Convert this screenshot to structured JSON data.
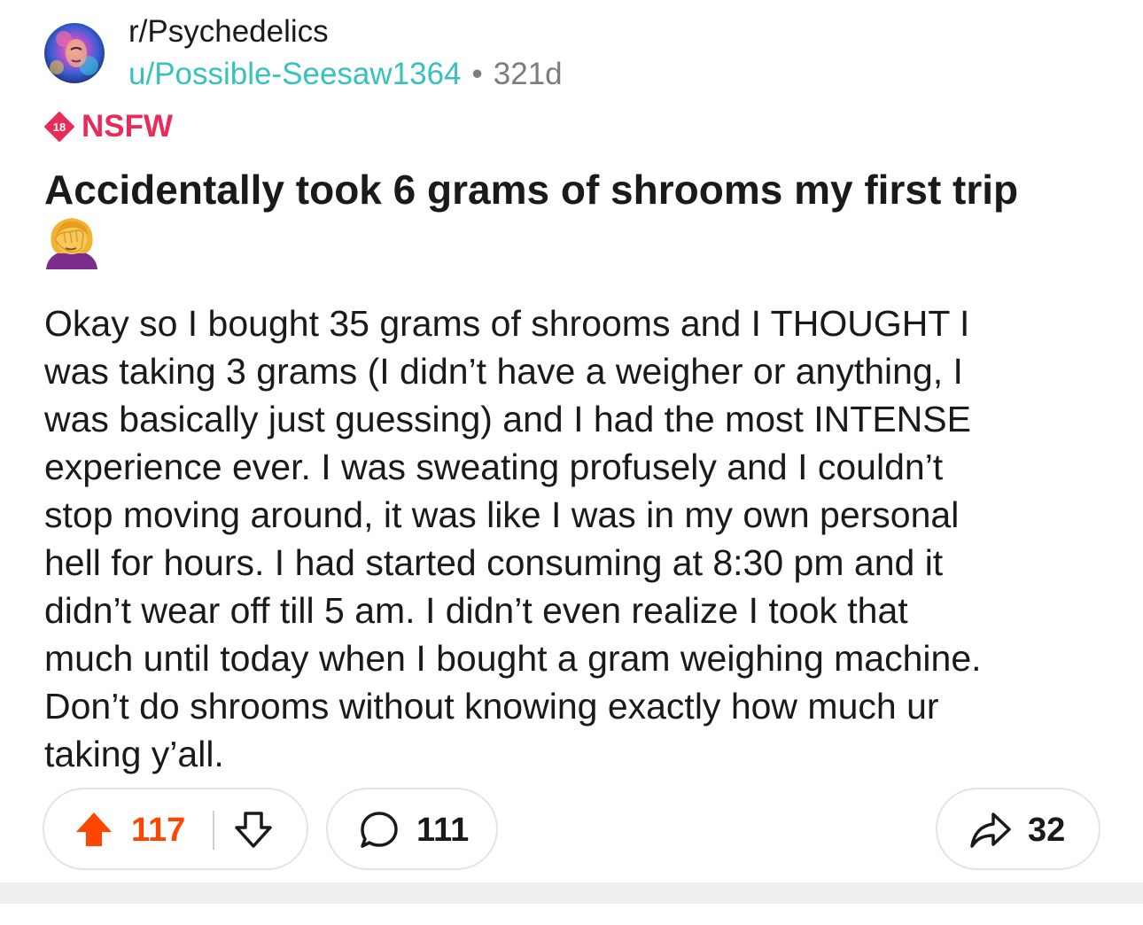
{
  "header": {
    "subreddit": "r/Psychedelics",
    "username": "u/Possible-Seesaw1364",
    "separator": "•",
    "age": "321d",
    "avatar_icon": "psychedelic-face-avatar"
  },
  "nsfw": {
    "badge_number": "18",
    "label": "NSFW",
    "color": "#e82c5a"
  },
  "post": {
    "title": "Accidentally took 6 grams of shrooms my first trip",
    "title_emoji": "woman-facepalming-emoji",
    "body_lines": [
      "Okay so I bought 35 grams of shrooms and I THOUGHT I",
      "was taking 3 grams (I didn’t have a weigher or anything, I",
      "was basically just guessing) and I had the most INTENSE",
      "experience ever. I was sweating profusely and I couldn’t",
      "stop moving around, it was like I was in my own personal",
      "hell for hours. I had started consuming at 8:30 pm and it",
      "didn’t wear off till 5 am. I didn’t even realize I took that",
      "much until today when I bought a gram weighing machine.",
      "Don’t do shrooms without knowing exactly how much ur",
      "taking y’all."
    ]
  },
  "actions": {
    "upvote_icon": "upvote-arrow-icon",
    "upvotes": "117",
    "downvote_icon": "downvote-arrow-icon",
    "comment_icon": "speech-bubble-icon",
    "comments": "111",
    "share_icon": "share-arrow-icon",
    "shares": "32"
  },
  "colors": {
    "accent_upvote": "#ff4500",
    "username": "#36c2bd",
    "meta_gray": "#7c7c7c"
  }
}
